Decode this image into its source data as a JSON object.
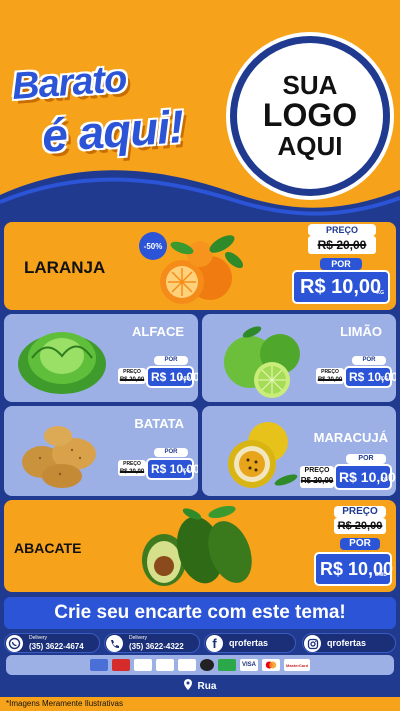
{
  "brand": {
    "line1": "Barato",
    "line2": "é aqui!"
  },
  "logo": {
    "line1": "SUA",
    "line2": "LOGO",
    "line3": "AQUI"
  },
  "discount_badge": "-50%",
  "products": [
    {
      "name": "LARANJA",
      "preco_label": "PREÇO",
      "old_price": "R$ 20,00",
      "por_label": "POR",
      "new_price": "R$ 10,00",
      "unit": "KG"
    },
    {
      "name": "ALFACE",
      "preco_label": "PREÇO",
      "old_price": "R$ 20,00",
      "por_label": "POR",
      "new_price": "R$ 10,00",
      "unit": "UNID"
    },
    {
      "name": "LIMÃO",
      "preco_label": "PREÇO",
      "old_price": "R$ 20,00",
      "por_label": "POR",
      "new_price": "R$ 10,00",
      "unit": "KG"
    },
    {
      "name": "BATATA",
      "preco_label": "PREÇO",
      "old_price": "R$ 20,00",
      "por_label": "POR",
      "new_price": "R$ 10,00",
      "unit": "KG"
    },
    {
      "name": "MARACUJÁ",
      "preco_label": "PREÇO",
      "old_price": "R$ 20,00",
      "por_label": "POR",
      "new_price": "R$ 10,00",
      "unit": "KG"
    },
    {
      "name": "ABACATE",
      "preco_label": "PREÇO",
      "old_price": "R$ 20,00",
      "por_label": "POR",
      "new_price": "R$ 10,00",
      "unit": "UNID"
    }
  ],
  "cta": "Crie seu encarte com este tema!",
  "contacts": {
    "whatsapp": {
      "label": "Delivery",
      "number": "(35) 3622-4674",
      "icon": "whatsapp-icon"
    },
    "phone": {
      "label": "Delivery",
      "number": "(35) 3622-4322",
      "icon": "phone-icon"
    },
    "facebook": {
      "handle": "qrofertas",
      "icon": "facebook-icon"
    },
    "instagram": {
      "handle": "qrofertas",
      "icon": "instagram-icon"
    }
  },
  "payments": [
    "VISA",
    "MasterCard"
  ],
  "address": {
    "text": "Rua",
    "icon": "location-pin-icon"
  },
  "footer_note": "*Imagens Meramente Ilustrativas",
  "colors": {
    "orange": "#f6a21a",
    "blue": "#2b54d6",
    "navy": "#1f3a8f",
    "light_blue": "#9db0e6"
  }
}
